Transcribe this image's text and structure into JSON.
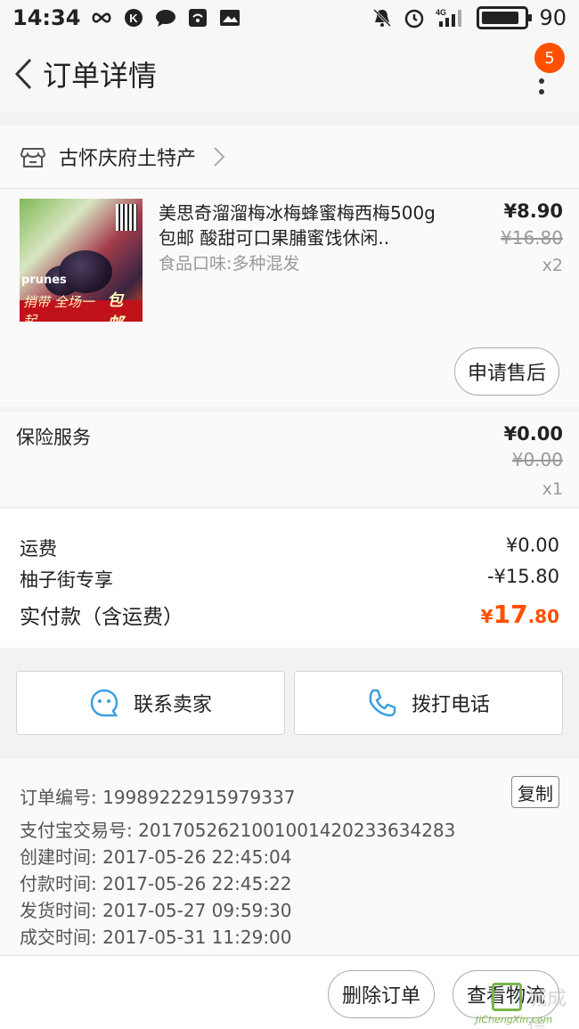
{
  "status_bar": {
    "time": "14:34",
    "network": "4G",
    "battery": "90",
    "battery_level": 0.9
  },
  "nav": {
    "title": "订单详情",
    "badge_count": "5"
  },
  "shop": {
    "name": "古怀庆府土特产"
  },
  "product": {
    "title": "美思奇溜溜梅冰梅蜂蜜梅西梅500g包邮 酸甜可口果脯蜜饯休闲..",
    "sku": "食品口味:多种混发",
    "price": "¥8.90",
    "original_price": "¥16.80",
    "quantity": "x2",
    "image_brand_text": "prunes",
    "image_banner_left": "捎带 全场一起",
    "image_banner_right": "包邮",
    "after_sale_label": "申请售后"
  },
  "insurance": {
    "title": "保险服务",
    "price": "¥0.00",
    "original_price": "¥0.00",
    "quantity": "x1"
  },
  "totals": {
    "shipping_label": "运费",
    "shipping_value": "¥0.00",
    "discount_label": "柚子街专享",
    "discount_value": "-¥15.80",
    "paid_label": "实付款（含运费）",
    "paid_currency": "¥",
    "paid_int": "17",
    "paid_dec": ".80"
  },
  "contact": {
    "seller_label": "联系卖家",
    "call_label": "拨打电话"
  },
  "order_info": {
    "order_no": "订单编号: 19989222915979337",
    "alipay_no": "支付宝交易号: 2017052621001001420233634283",
    "created": "创建时间: 2017-05-26 22:45:04",
    "paid": "付款时间: 2017-05-26 22:45:22",
    "shipped": "发货时间: 2017-05-27 09:59:30",
    "completed": "成交时间: 2017-05-31 11:29:00",
    "copy_label": "复制"
  },
  "actions": {
    "delete_label": "删除订单",
    "logistics_label": "查看物流"
  },
  "watermark": {
    "text": "城成信",
    "url": "JiChengXin.com"
  },
  "colors": {
    "accent": "#ff5000",
    "link_blue": "#3a9fe0",
    "watermark_green": "#7ab648"
  }
}
